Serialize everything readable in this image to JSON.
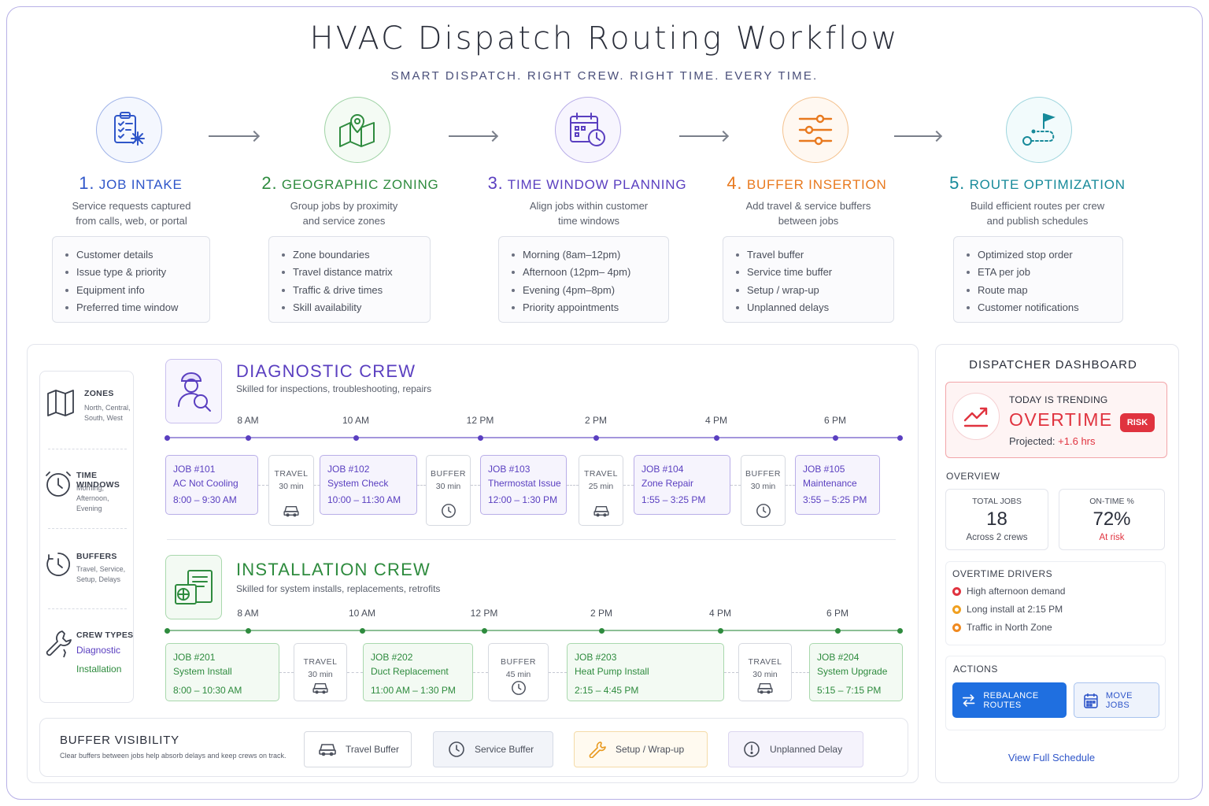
{
  "title": "HVAC Dispatch Routing Workflow",
  "subtitle": "SMART DISPATCH. RIGHT CREW. RIGHT TIME. EVERY TIME.",
  "steps": [
    {
      "num": "1.",
      "title": "JOB INTAKE",
      "desc1": "Service requests captured",
      "desc2": "from calls, web, or portal",
      "items": [
        "Customer details",
        "Issue type & priority",
        "Equipment info",
        "Preferred time window"
      ],
      "color": "#2f56c9",
      "icon": "clipboard-snowflake-icon"
    },
    {
      "num": "2.",
      "title": "GEOGRAPHIC ZONING",
      "desc1": "Group jobs by proximity",
      "desc2": "and service zones",
      "items": [
        "Zone boundaries",
        "Travel distance matrix",
        "Traffic & drive times",
        "Skill availability"
      ],
      "color": "#2e8b3e",
      "icon": "map-pin-icon"
    },
    {
      "num": "3.",
      "title": "TIME WINDOW PLANNING",
      "desc1": "Align jobs within customer",
      "desc2": "time windows",
      "items": [
        "Morning (8am–12pm)",
        "Afternoon (12pm– 4pm)",
        "Evening (4pm–8pm)",
        "Priority appointments"
      ],
      "color": "#5a3fc0",
      "icon": "calendar-clock-icon"
    },
    {
      "num": "4.",
      "title": "BUFFER INSERTION",
      "desc1": "Add travel & service buffers",
      "desc2": "between jobs",
      "items": [
        "Travel buffer",
        "Service time buffer",
        "Setup / wrap-up",
        "Unplanned delays"
      ],
      "color": "#e8791e",
      "icon": "sliders-icon"
    },
    {
      "num": "5.",
      "title": "ROUTE OPTIMIZATION",
      "desc1": "Build efficient routes per crew",
      "desc2": "and publish schedules",
      "items": [
        "Optimized stop order",
        "ETA per job",
        "Route map",
        "Customer notifications"
      ],
      "color": "#178a9a",
      "icon": "route-flag-icon"
    }
  ],
  "legend": [
    {
      "title": "ZONES",
      "sub": [
        "North, Central,",
        "South, West"
      ]
    },
    {
      "title": "TIME WINDOWS",
      "sub": [
        "Morning, Afternoon,",
        "Evening"
      ]
    },
    {
      "title": "BUFFERS",
      "sub": [
        "Travel, Service,",
        "Setup, Delays"
      ]
    },
    {
      "title": "CREW TYPES",
      "sub": [
        "Diagnostic",
        "Installation"
      ]
    }
  ],
  "crews": [
    {
      "name": "DIAGNOSTIC CREW",
      "desc": "Skilled for inspections, troubleshooting, repairs",
      "color": "#5a3fc0",
      "bg": "#f6f4fd",
      "border": "#b9aee8",
      "ticks": [
        "8 AM",
        "10 AM",
        "12 PM",
        "2 PM",
        "4 PM",
        "6 PM"
      ],
      "jobs": [
        {
          "id": "JOB #101",
          "name": "AC Not Cooling",
          "time": "8:00 – 9:30 AM"
        },
        {
          "id": "JOB #102",
          "name": "System Check",
          "time": "10:00 – 11:30 AM"
        },
        {
          "id": "JOB #103",
          "name": "Thermostat Issue",
          "time": "12:00 – 1:30 PM"
        },
        {
          "id": "JOB #104",
          "name": "Zone Repair",
          "time": "1:55 – 3:25 PM"
        },
        {
          "id": "JOB #105",
          "name": "Maintenance",
          "time": "3:55 – 5:25 PM"
        }
      ],
      "gaps": [
        {
          "type": "TRAVEL",
          "dur": "30 min",
          "icon": "car-icon"
        },
        {
          "type": "BUFFER",
          "dur": "30 min",
          "icon": "clock-icon"
        },
        {
          "type": "TRAVEL",
          "dur": "25 min",
          "icon": "car-icon"
        },
        {
          "type": "BUFFER",
          "dur": "30 min",
          "icon": "clock-icon"
        }
      ]
    },
    {
      "name": "INSTALLATION CREW",
      "desc": "Skilled for system installs, replacements, retrofits",
      "color": "#2e8b3e",
      "bg": "#f3faf3",
      "border": "#a9d8ad",
      "ticks": [
        "8 AM",
        "10 AM",
        "12 PM",
        "2 PM",
        "4 PM",
        "6 PM"
      ],
      "jobs": [
        {
          "id": "JOB #201",
          "name": "System Install",
          "time": "8:00 – 10:30 AM"
        },
        {
          "id": "JOB #202",
          "name": "Duct Replacement",
          "time": "11:00 AM – 1:30 PM"
        },
        {
          "id": "JOB #203",
          "name": "Heat Pump Install",
          "time": "2:15 – 4:45 PM"
        },
        {
          "id": "JOB #204",
          "name": "System Upgrade",
          "time": "5:15 – 7:15 PM"
        }
      ],
      "gaps": [
        {
          "type": "TRAVEL",
          "dur": "30 min",
          "icon": "car-icon"
        },
        {
          "type": "BUFFER",
          "dur": "45 min",
          "icon": "clock-icon"
        },
        {
          "type": "TRAVEL",
          "dur": "30 min",
          "icon": "car-icon"
        }
      ]
    }
  ],
  "buffer_visibility": {
    "title": "BUFFER VISIBILITY",
    "desc": "Clear buffers between jobs help absorb delays and keep crews on track.",
    "chips": [
      {
        "label": "Travel Buffer",
        "icon": "car-icon"
      },
      {
        "label": "Service Buffer",
        "icon": "clock-icon"
      },
      {
        "label": "Setup / Wrap-up",
        "icon": "wrench-icon"
      },
      {
        "label": "Unplanned Delay",
        "icon": "alert-icon"
      }
    ]
  },
  "dashboard": {
    "title": "DISPATCHER DASHBOARD",
    "alert": {
      "line1": "TODAY IS TRENDING",
      "status": "OVERTIME",
      "badge": "RISK",
      "proj_label": "Projected:",
      "proj_value": "+1.6 hrs"
    },
    "overview_label": "OVERVIEW",
    "kpis": [
      {
        "label": "TOTAL JOBS",
        "value": "18",
        "sub": "Across 2 crews"
      },
      {
        "label": "ON-TIME %",
        "value": "72%",
        "sub": "At risk"
      }
    ],
    "drivers_label": "OVERTIME DRIVERS",
    "drivers": [
      {
        "text": "High afternoon demand",
        "color": "#e0333f"
      },
      {
        "text": "Long install at 2:15 PM",
        "color": "#f0a020"
      },
      {
        "text": "Traffic in North Zone",
        "color": "#f08a20"
      }
    ],
    "actions_label": "ACTIONS",
    "rebalance": "REBALANCE ROUTES",
    "move": "MOVE JOBS",
    "view_full": "View Full Schedule"
  }
}
